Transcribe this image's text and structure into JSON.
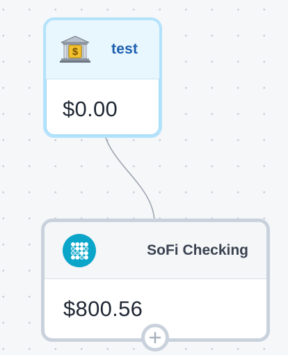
{
  "canvas": {
    "background": "#f5f7f9",
    "dot_color": "#c9d0d8"
  },
  "nodes": {
    "test": {
      "icon": "bank-building-icon",
      "name": "test",
      "amount": "$0.00",
      "accent": "#1c5fae",
      "border_color": "#b3e2fb"
    },
    "sofi": {
      "icon": "sofi-logo-icon",
      "name": "SoFi Checking",
      "amount": "$800.56",
      "brand_color": "#0aa5c8",
      "border_color": "#c9d2dc"
    }
  },
  "connector": {
    "icon": "plus-icon"
  }
}
